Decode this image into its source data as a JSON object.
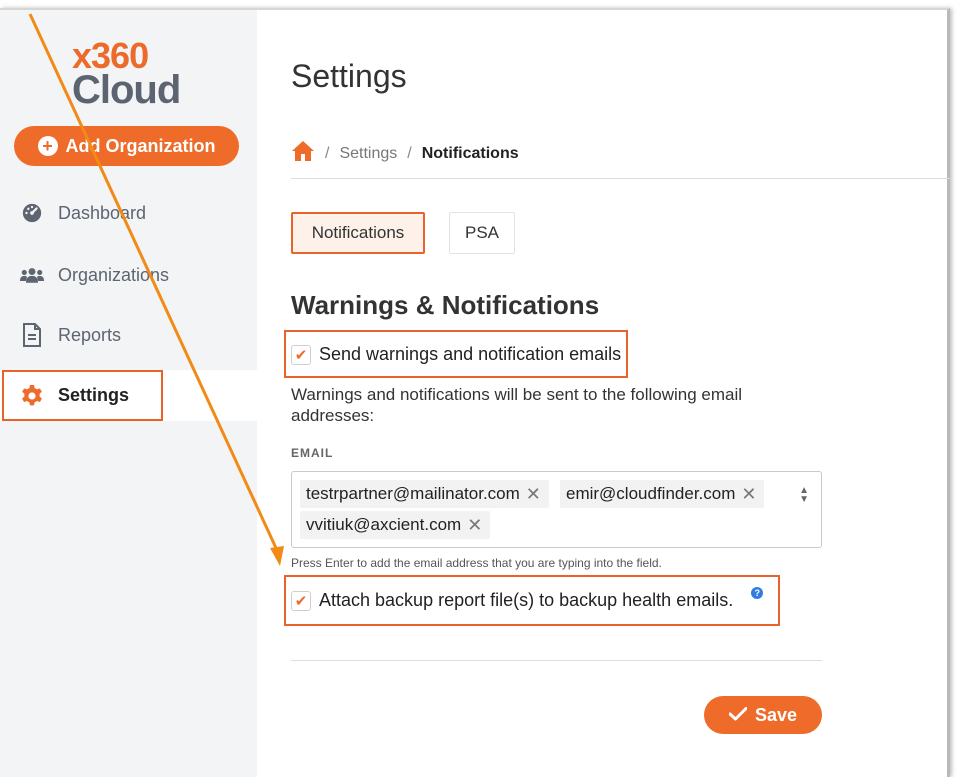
{
  "logo": {
    "line1": "x360",
    "line2": "Cloud"
  },
  "sidebar": {
    "add_button": "Add Organization",
    "items": [
      {
        "label": "Dashboard",
        "icon": "dashboard-gauge-icon"
      },
      {
        "label": "Organizations",
        "icon": "users-icon"
      },
      {
        "label": "Reports",
        "icon": "document-icon"
      },
      {
        "label": "Settings",
        "icon": "gear-icon",
        "active": true
      }
    ]
  },
  "page": {
    "title": "Settings",
    "breadcrumb": {
      "home_icon": "home-icon",
      "sep": "/",
      "items": [
        "Settings",
        "Notifications"
      ]
    },
    "tabs": [
      "Notifications",
      "PSA"
    ],
    "section_title": "Warnings & Notifications",
    "send_checkbox": {
      "label": "Send warnings and notification emails",
      "checked": true
    },
    "description": "Warnings and notifications will be sent to the following email addresses:",
    "email_label": "EMAIL",
    "emails": [
      "testrpartner@mailinator.com",
      "emir@cloudfinder.com",
      "vvitiuk@axcient.com"
    ],
    "hint": "Press Enter to add the email address that you are typing into the field.",
    "attach_checkbox": {
      "label": "Attach backup report file(s) to backup health emails.",
      "checked": true
    },
    "help_icon_glyph": "?",
    "save_button": "Save"
  },
  "colors": {
    "accent": "#ee6b2a",
    "sidebar_bg": "#f3f4f6",
    "logo_gray": "#5b6470",
    "help_blue": "#2f7de1"
  }
}
